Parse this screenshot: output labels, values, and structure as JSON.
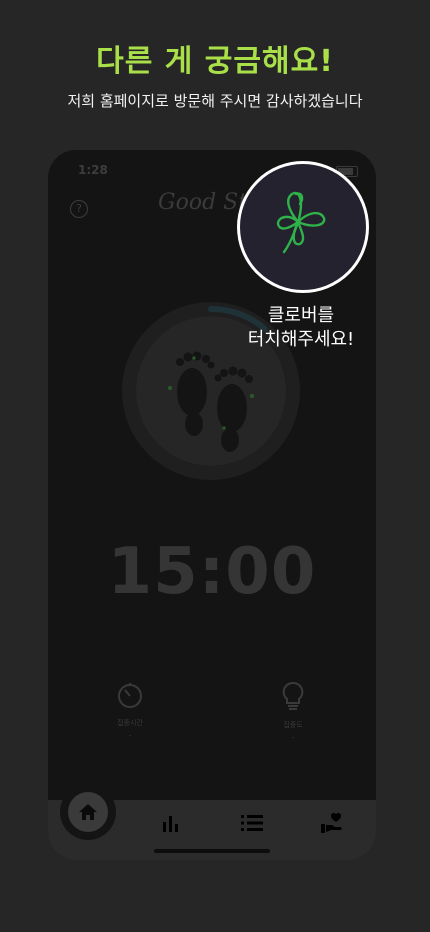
{
  "promo": {
    "headline": "다른 게 궁금해요!",
    "subline": "저희 홈페이지로 방문해 주시면 감사하겠습니다"
  },
  "phone": {
    "status_time": "1:28",
    "logo_text": "Good St",
    "timer": "15:00",
    "progress_fraction": 0.12,
    "stats": {
      "focus_time_label": "집중시간",
      "focus_time_value": "-",
      "focus_level_label": "집중도",
      "focus_level_value": "-"
    },
    "tabs": [
      "home-icon",
      "bar-chart-icon",
      "list-icon",
      "hand-heart-icon"
    ]
  },
  "clover_hint": {
    "line1": "클로버를",
    "line2": "터치해주세요!",
    "clover_color": "#2fb24a"
  },
  "colors": {
    "accent": "#a9e04a",
    "background": "#262626",
    "phone_bg": "#141414"
  }
}
